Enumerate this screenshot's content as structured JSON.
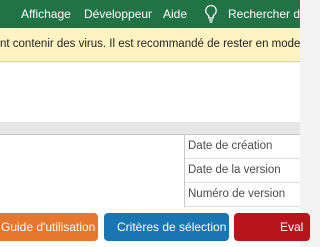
{
  "ribbon": {
    "tabs": [
      {
        "label": "Affichage"
      },
      {
        "label": "Développeur"
      },
      {
        "label": "Aide"
      }
    ],
    "tell_me": {
      "icon": "lightbulb-icon",
      "label": "Rechercher des"
    }
  },
  "protected_view": {
    "message": "nt contenir des virus. Il est recommandé de rester en mode protégé"
  },
  "properties": [
    {
      "label": "Date de création"
    },
    {
      "label": "Date de la version"
    },
    {
      "label": "Numéro de version"
    }
  ],
  "buttons": {
    "guide": "Guide d'utilisation",
    "criteres": "Critères de sélection",
    "eval": "Eval"
  },
  "colors": {
    "ribbon": "#217346",
    "warning_bar": "#fff4c1",
    "guide_button": "#e8772e",
    "criteres_button": "#1a75b3",
    "eval_button": "#b8141c"
  }
}
